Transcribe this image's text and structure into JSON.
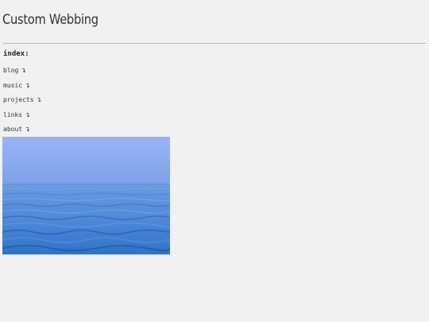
{
  "site": {
    "title": "Custom Webbing"
  },
  "index": {
    "heading": "index:",
    "items": [
      {
        "label": "blog",
        "arrow": "↴"
      },
      {
        "label": "music",
        "arrow": "↴"
      },
      {
        "label": "projects",
        "arrow": "↴"
      },
      {
        "label": "links",
        "arrow": "↴"
      },
      {
        "label": "about",
        "arrow": "↴"
      }
    ]
  },
  "image": {
    "subject": "calm blue sea under a pale blue sky",
    "colors": {
      "sky_top": "#9ab3f4",
      "sky_bottom": "#7da1ea",
      "sea_top": "#5e93de",
      "sea_bottom": "#2f73c8"
    }
  }
}
